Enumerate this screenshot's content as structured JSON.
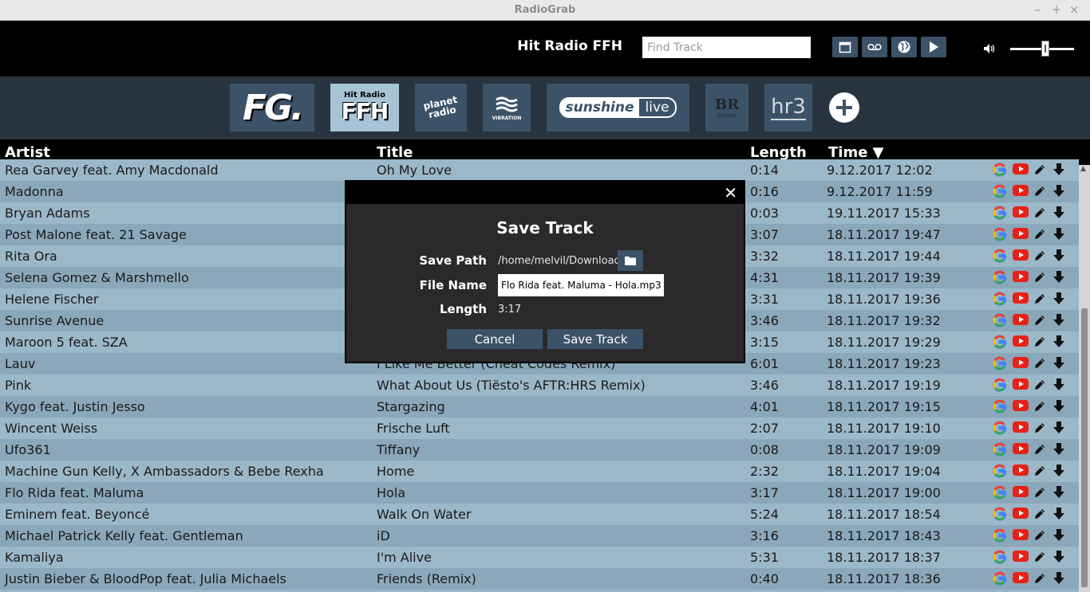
{
  "window": {
    "title": "RadioGrab",
    "controls": {
      "minimize": "–",
      "maximize": "+",
      "close": "×"
    }
  },
  "header": {
    "station_name": "Hit Radio FFH",
    "search_placeholder": "Find Track",
    "buttons": [
      "calendar-icon",
      "record-icon",
      "globe-icon",
      "play-icon"
    ]
  },
  "volume": {
    "icon": "speaker-icon",
    "level": 0.55
  },
  "stations": [
    {
      "logo_text": "FG.",
      "selected": false
    },
    {
      "logo_text_top": "Hit Radio",
      "logo_text": "FFH",
      "selected": true
    },
    {
      "logo_text": "planet radio",
      "selected": false
    },
    {
      "logo_text": "VIBRATION",
      "selected": false
    },
    {
      "logo_text": "sunshine",
      "logo_text_suffix": "live",
      "selected": false
    },
    {
      "logo_text": "BR",
      "logo_text_sub": "KLASSIK",
      "selected": false
    },
    {
      "logo_text": "hr3",
      "selected": false
    }
  ],
  "table": {
    "headers": {
      "artist": "Artist",
      "title": "Title",
      "length": "Length",
      "time": "Time ▼"
    },
    "rows": [
      {
        "artist": "Rea Garvey feat. Amy Macdonald",
        "title": "Oh My Love",
        "length": "0:14",
        "time": "9.12.2017 12:02"
      },
      {
        "artist": "Madonna",
        "title": "",
        "length": "0:16",
        "time": "9.12.2017 11:59"
      },
      {
        "artist": "Bryan Adams",
        "title": "",
        "length": "0:03",
        "time": "19.11.2017 15:33"
      },
      {
        "artist": "Post Malone feat. 21 Savage",
        "title": "",
        "length": "3:07",
        "time": "18.11.2017 19:47"
      },
      {
        "artist": "Rita Ora",
        "title": "",
        "length": "3:32",
        "time": "18.11.2017 19:44"
      },
      {
        "artist": "Selena Gomez & Marshmello",
        "title": "",
        "length": "4:31",
        "time": "18.11.2017 19:39"
      },
      {
        "artist": "Helene Fischer",
        "title": "",
        "length": "3:31",
        "time": "18.11.2017 19:36"
      },
      {
        "artist": "Sunrise Avenue",
        "title": "",
        "length": "3:46",
        "time": "18.11.2017 19:32"
      },
      {
        "artist": "Maroon 5 feat. SZA",
        "title": "",
        "length": "3:15",
        "time": "18.11.2017 19:29"
      },
      {
        "artist": "Lauv",
        "title": "I Like Me Better (Cheat Codes Remix)",
        "length": "6:01",
        "time": "18.11.2017 19:23"
      },
      {
        "artist": "Pink",
        "title": "What About Us (Tiësto's AFTR:HRS Remix)",
        "length": "3:46",
        "time": "18.11.2017 19:19"
      },
      {
        "artist": "Kygo feat. Justin Jesso",
        "title": "Stargazing",
        "length": "4:01",
        "time": "18.11.2017 19:15"
      },
      {
        "artist": "Wincent Weiss",
        "title": "Frische Luft",
        "length": "2:07",
        "time": "18.11.2017 19:10"
      },
      {
        "artist": "Ufo361",
        "title": "Tiffany",
        "length": "0:08",
        "time": "18.11.2017 19:09"
      },
      {
        "artist": "Machine Gun Kelly, X Ambassadors & Bebe Rexha",
        "title": "Home",
        "length": "2:32",
        "time": "18.11.2017 19:04"
      },
      {
        "artist": "Flo Rida feat. Maluma",
        "title": "Hola",
        "length": "3:17",
        "time": "18.11.2017 19:00"
      },
      {
        "artist": "Eminem feat. Beyoncé",
        "title": "Walk On Water",
        "length": "5:24",
        "time": "18.11.2017 18:54"
      },
      {
        "artist": "Michael Patrick Kelly feat. Gentleman",
        "title": "iD",
        "length": "3:16",
        "time": "18.11.2017 18:43"
      },
      {
        "artist": "Kamaliya",
        "title": "I'm Alive",
        "length": "5:31",
        "time": "18.11.2017 18:37"
      },
      {
        "artist": "Justin Bieber & BloodPop feat. Julia Michaels",
        "title": "Friends (Remix)",
        "length": "0:40",
        "time": "18.11.2017 18:36"
      }
    ],
    "row_actions": [
      "google-icon",
      "youtube-icon",
      "pencil-icon",
      "download-icon"
    ]
  },
  "dialog": {
    "title": "Save Track",
    "save_path_label": "Save Path",
    "save_path_value": "/home/melvil/Downloads",
    "file_name_label": "File Name",
    "file_name_value": "Flo Rida feat. Maluma - Hola.mp3",
    "length_label": "Length",
    "length_value": "3:17",
    "cancel_label": "Cancel",
    "save_label": "Save Track",
    "close": "✕"
  },
  "colors": {
    "accent": "#3c5268",
    "row_light": "#9bb8c8",
    "row_dark": "#8aa8ba",
    "youtube": "#e62117"
  }
}
